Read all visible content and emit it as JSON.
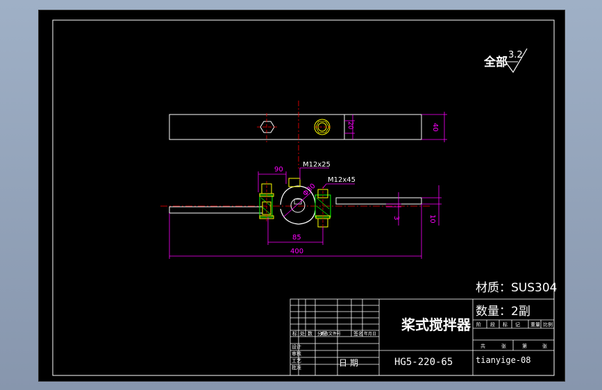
{
  "surface_finish": {
    "prefix": "全部",
    "value": "3.2"
  },
  "dimensions": {
    "top_width": "40",
    "top_hole_offset": "20",
    "bolt_spacing": "90",
    "bolt_top": "M12x25",
    "bolt_right": "M12x45",
    "shaft_diameter": "Φ30",
    "bolt_spacing_bottom": "85",
    "overall_length": "400",
    "thickness_small": "3",
    "thickness": "10"
  },
  "title_block": {
    "material": "材质：SUS304",
    "quantity": "数量：2副",
    "part_name": "桨式搅拌器",
    "drawing_number": "HG5-220-65",
    "author": "tianyige-08",
    "date_label": "日 期",
    "row_labels": [
      "标",
      "处",
      "数",
      "分区",
      "更改文件号",
      "签名",
      "年月日"
    ],
    "left_labels": [
      "设计",
      "审核",
      "工艺",
      "批准"
    ],
    "right_header": [
      "阶",
      "段",
      "标",
      "记",
      "重量",
      "比例"
    ],
    "right_lower": [
      "共",
      "张",
      "第",
      "张"
    ]
  },
  "colors": {
    "background": "#000000",
    "frame": "#ffffff",
    "part_outline": "#ffffff",
    "dimension": "#ff00ff",
    "centerline": "#ff0000",
    "hardware": "#ffff00",
    "hatch": "#00ff00"
  }
}
